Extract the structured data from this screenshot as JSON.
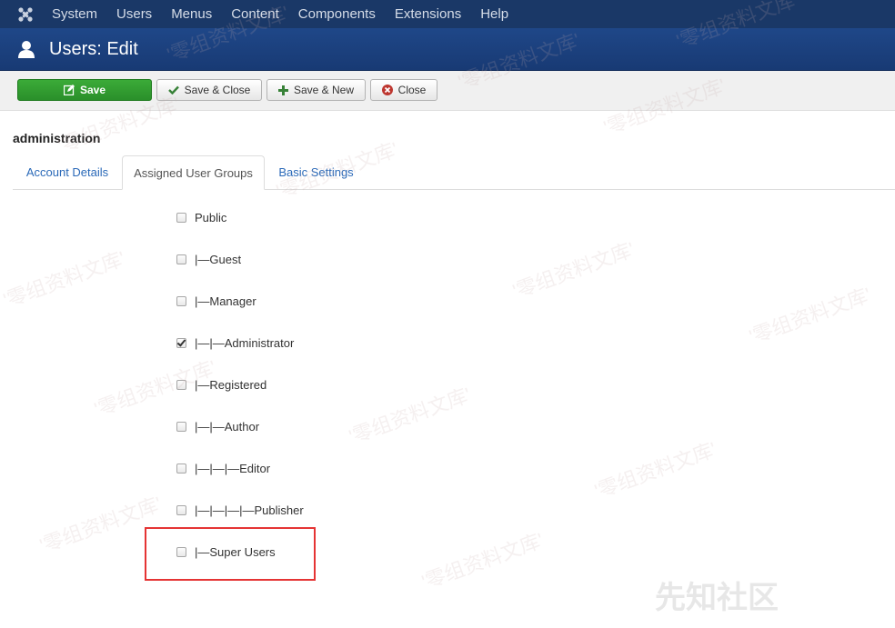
{
  "topnav": {
    "items": [
      "System",
      "Users",
      "Menus",
      "Content",
      "Components",
      "Extensions",
      "Help"
    ]
  },
  "titlebar": {
    "title": "Users: Edit"
  },
  "toolbar": {
    "save": "Save",
    "save_close": "Save & Close",
    "save_new": "Save & New",
    "close": "Close"
  },
  "section_title": "administration",
  "tabs": [
    "Account Details",
    "Assigned User Groups",
    "Basic Settings"
  ],
  "groups": [
    {
      "label": "Public",
      "checked": false
    },
    {
      "label": "|—Guest",
      "checked": false
    },
    {
      "label": "|—Manager",
      "checked": false
    },
    {
      "label": "|—|—Administrator",
      "checked": true
    },
    {
      "label": "|—Registered",
      "checked": false
    },
    {
      "label": "|—|—Author",
      "checked": false
    },
    {
      "label": "|—|—|—Editor",
      "checked": false
    },
    {
      "label": "|—|—|—|—Publisher",
      "checked": false
    },
    {
      "label": "|—Super Users",
      "checked": false
    }
  ],
  "watermark": "'零组资料文库'",
  "corner_mark": "先知社区",
  "colors": {
    "nav": "#1a3867",
    "title": "#1d4281",
    "save": "#2e962e",
    "highlight": "#e53434"
  }
}
